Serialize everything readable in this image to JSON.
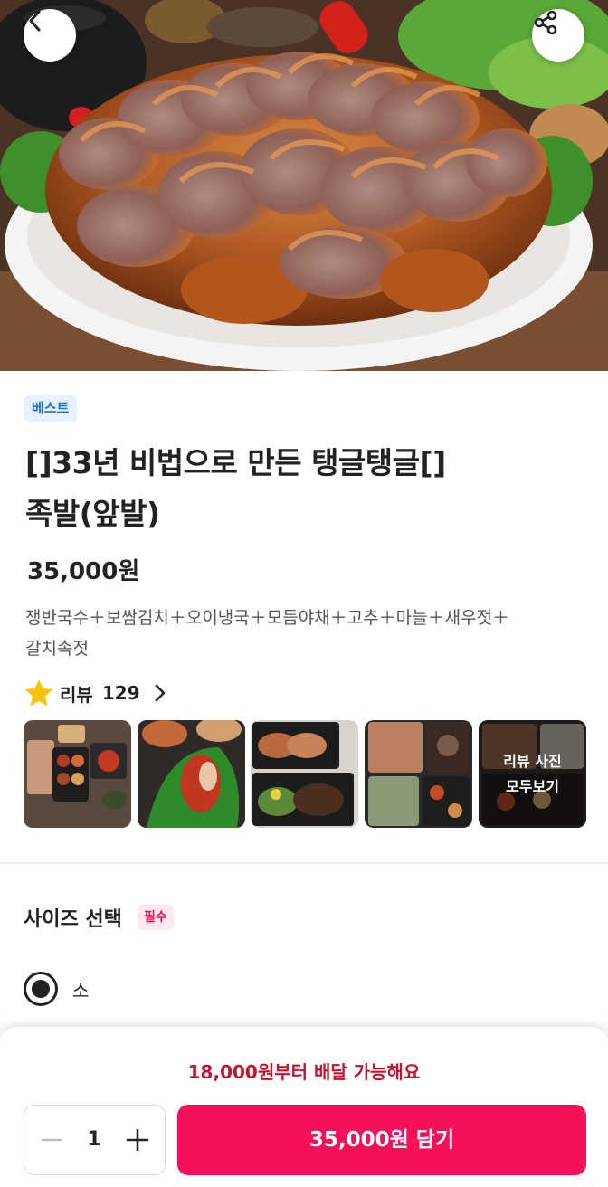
{
  "hero": {
    "image": "braised-pork-hocks-platter",
    "back_icon": "chevron-left-icon",
    "share_icon": "share-icon"
  },
  "product": {
    "badge": "베스트",
    "title_line1": "[]33년 비법으로 만든 탱글탱글[]",
    "title_line2": "족발(앞발)",
    "price": "35,000원",
    "desc_line1": "쟁반국수＋보쌈김치＋오이냉국＋모듬야채＋고추＋마늘＋새우젓＋",
    "desc_line2": "갈치속젓"
  },
  "reviews": {
    "label": "리뷰",
    "count": "129",
    "star_color": "#ffc107",
    "thumbnails": [
      "food-delivery-photo",
      "food-delivery-photo",
      "food-delivery-photo",
      "food-delivery-photo",
      "food-delivery-photo"
    ],
    "see_all_line1": "리뷰 사진",
    "see_all_line2": "모두보기"
  },
  "size_section": {
    "title": "사이즈 선택",
    "required_badge": "필수",
    "selected_option": "소"
  },
  "bottom_sheet": {
    "delivery_note": "18,000원부터 배달 가능해요",
    "quantity": "1",
    "add_button": "35,000원 담기",
    "accent_color": "#f5115a"
  }
}
